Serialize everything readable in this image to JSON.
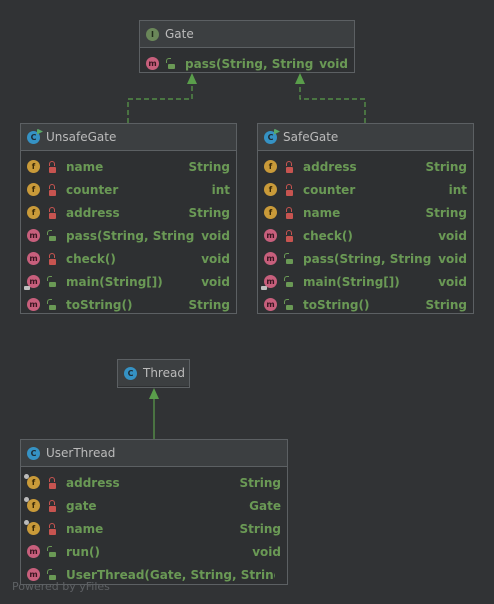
{
  "diagram": {
    "classes": [
      {
        "id": "Gate",
        "kind": "interface",
        "kind_letter": "I",
        "name": "Gate",
        "members": [
          {
            "icon": "method",
            "icon_letter": "m",
            "abstract": true,
            "visibility": "public",
            "name": "pass(String, String)",
            "type": "void"
          }
        ]
      },
      {
        "id": "UnsafeGate",
        "kind": "class",
        "kind_letter": "C",
        "runnable": true,
        "name": "UnsafeGate",
        "members": [
          {
            "icon": "field",
            "icon_letter": "f",
            "visibility": "private",
            "name": "name",
            "type": "String"
          },
          {
            "icon": "field",
            "icon_letter": "f",
            "visibility": "private",
            "name": "counter",
            "type": "int"
          },
          {
            "icon": "field",
            "icon_letter": "f",
            "visibility": "private",
            "name": "address",
            "type": "String"
          },
          {
            "icon": "method",
            "icon_letter": "m",
            "visibility": "public",
            "name": "pass(String, String)",
            "type": "void"
          },
          {
            "icon": "method",
            "icon_letter": "m",
            "visibility": "private",
            "name": "check()",
            "type": "void"
          },
          {
            "icon": "method",
            "icon_letter": "m",
            "static": true,
            "visibility": "public",
            "name": "main(String[])",
            "type": "void"
          },
          {
            "icon": "method",
            "icon_letter": "m",
            "visibility": "public",
            "name": "toString()",
            "type": "String"
          }
        ]
      },
      {
        "id": "SafeGate",
        "kind": "class",
        "kind_letter": "C",
        "runnable": true,
        "name": "SafeGate",
        "members": [
          {
            "icon": "field",
            "icon_letter": "f",
            "visibility": "private",
            "name": "address",
            "type": "String"
          },
          {
            "icon": "field",
            "icon_letter": "f",
            "visibility": "private",
            "name": "counter",
            "type": "int"
          },
          {
            "icon": "field",
            "icon_letter": "f",
            "visibility": "private",
            "name": "name",
            "type": "String"
          },
          {
            "icon": "method",
            "icon_letter": "m",
            "visibility": "private",
            "name": "check()",
            "type": "void"
          },
          {
            "icon": "method",
            "icon_letter": "m",
            "visibility": "public",
            "name": "pass(String, String)",
            "type": "void"
          },
          {
            "icon": "method",
            "icon_letter": "m",
            "static": true,
            "visibility": "public",
            "name": "main(String[])",
            "type": "void"
          },
          {
            "icon": "method",
            "icon_letter": "m",
            "visibility": "public",
            "name": "toString()",
            "type": "String"
          }
        ]
      },
      {
        "id": "Thread",
        "kind": "class",
        "kind_letter": "C",
        "name": "Thread",
        "members": []
      },
      {
        "id": "UserThread",
        "kind": "class",
        "kind_letter": "C",
        "name": "UserThread",
        "members": [
          {
            "icon": "field",
            "icon_letter": "f",
            "final": true,
            "visibility": "private",
            "name": "address",
            "type": "String"
          },
          {
            "icon": "field",
            "icon_letter": "f",
            "final": true,
            "visibility": "private",
            "name": "gate",
            "type": "Gate"
          },
          {
            "icon": "field",
            "icon_letter": "f",
            "final": true,
            "visibility": "private",
            "name": "name",
            "type": "String"
          },
          {
            "icon": "method",
            "icon_letter": "m",
            "visibility": "public",
            "name": "run()",
            "type": "void"
          },
          {
            "icon": "method",
            "icon_letter": "m",
            "visibility": "public",
            "name": "UserThread(Gate, String, String)",
            "type": ""
          }
        ]
      }
    ],
    "relations": [
      {
        "from": "UnsafeGate",
        "to": "Gate",
        "type": "implements",
        "style": "dashed"
      },
      {
        "from": "SafeGate",
        "to": "Gate",
        "type": "implements",
        "style": "dashed"
      },
      {
        "from": "UserThread",
        "to": "Thread",
        "type": "extends",
        "style": "solid"
      }
    ],
    "colors": {
      "background": "#313335",
      "member_text": "#6a9955",
      "header_text": "#bbbbbb",
      "edge": "#5a9e4b",
      "field_icon": "#c99a39",
      "method_icon": "#c75f7c",
      "class_icon": "#3592c4",
      "interface_icon": "#6a8759"
    }
  },
  "watermark": "Powered by yFiles"
}
